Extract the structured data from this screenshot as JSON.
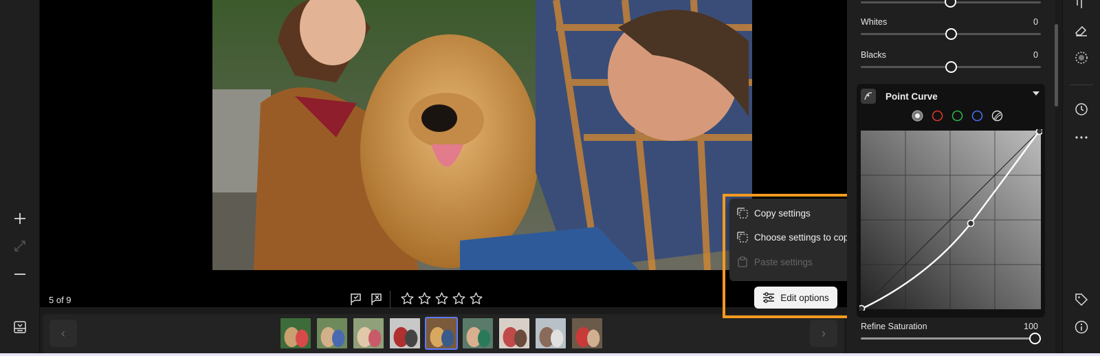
{
  "viewer": {
    "counter": "5 of 9",
    "rating_stars": 5
  },
  "context_menu": {
    "items": [
      {
        "label": "Copy settings",
        "icon": "copy-settings-icon",
        "disabled": false
      },
      {
        "label": "Choose settings to copy",
        "icon": "choose-settings-icon",
        "disabled": false
      },
      {
        "label": "Paste settings",
        "icon": "paste-settings-icon",
        "disabled": true
      }
    ],
    "edit_options_label": "Edit options"
  },
  "panel": {
    "sliders": [
      {
        "label": "Whites",
        "value": "0",
        "fraction": 0.5
      },
      {
        "label": "Blacks",
        "value": "0",
        "fraction": 0.5
      }
    ],
    "point_curve": {
      "title": "Point Curve",
      "channels": [
        "master",
        "red",
        "green",
        "blue",
        "luminance"
      ]
    },
    "refine_saturation": {
      "label": "Refine Saturation",
      "value": "100",
      "fraction": 1.0
    }
  },
  "colors": {
    "accent_highlight": "#f39a1f",
    "active_thumb": "#5d7bff",
    "red": "#e0352b",
    "green": "#2bb44a",
    "blue": "#4a6cf0"
  },
  "filmstrip": {
    "thumb_count": 9,
    "active_index": 4
  }
}
